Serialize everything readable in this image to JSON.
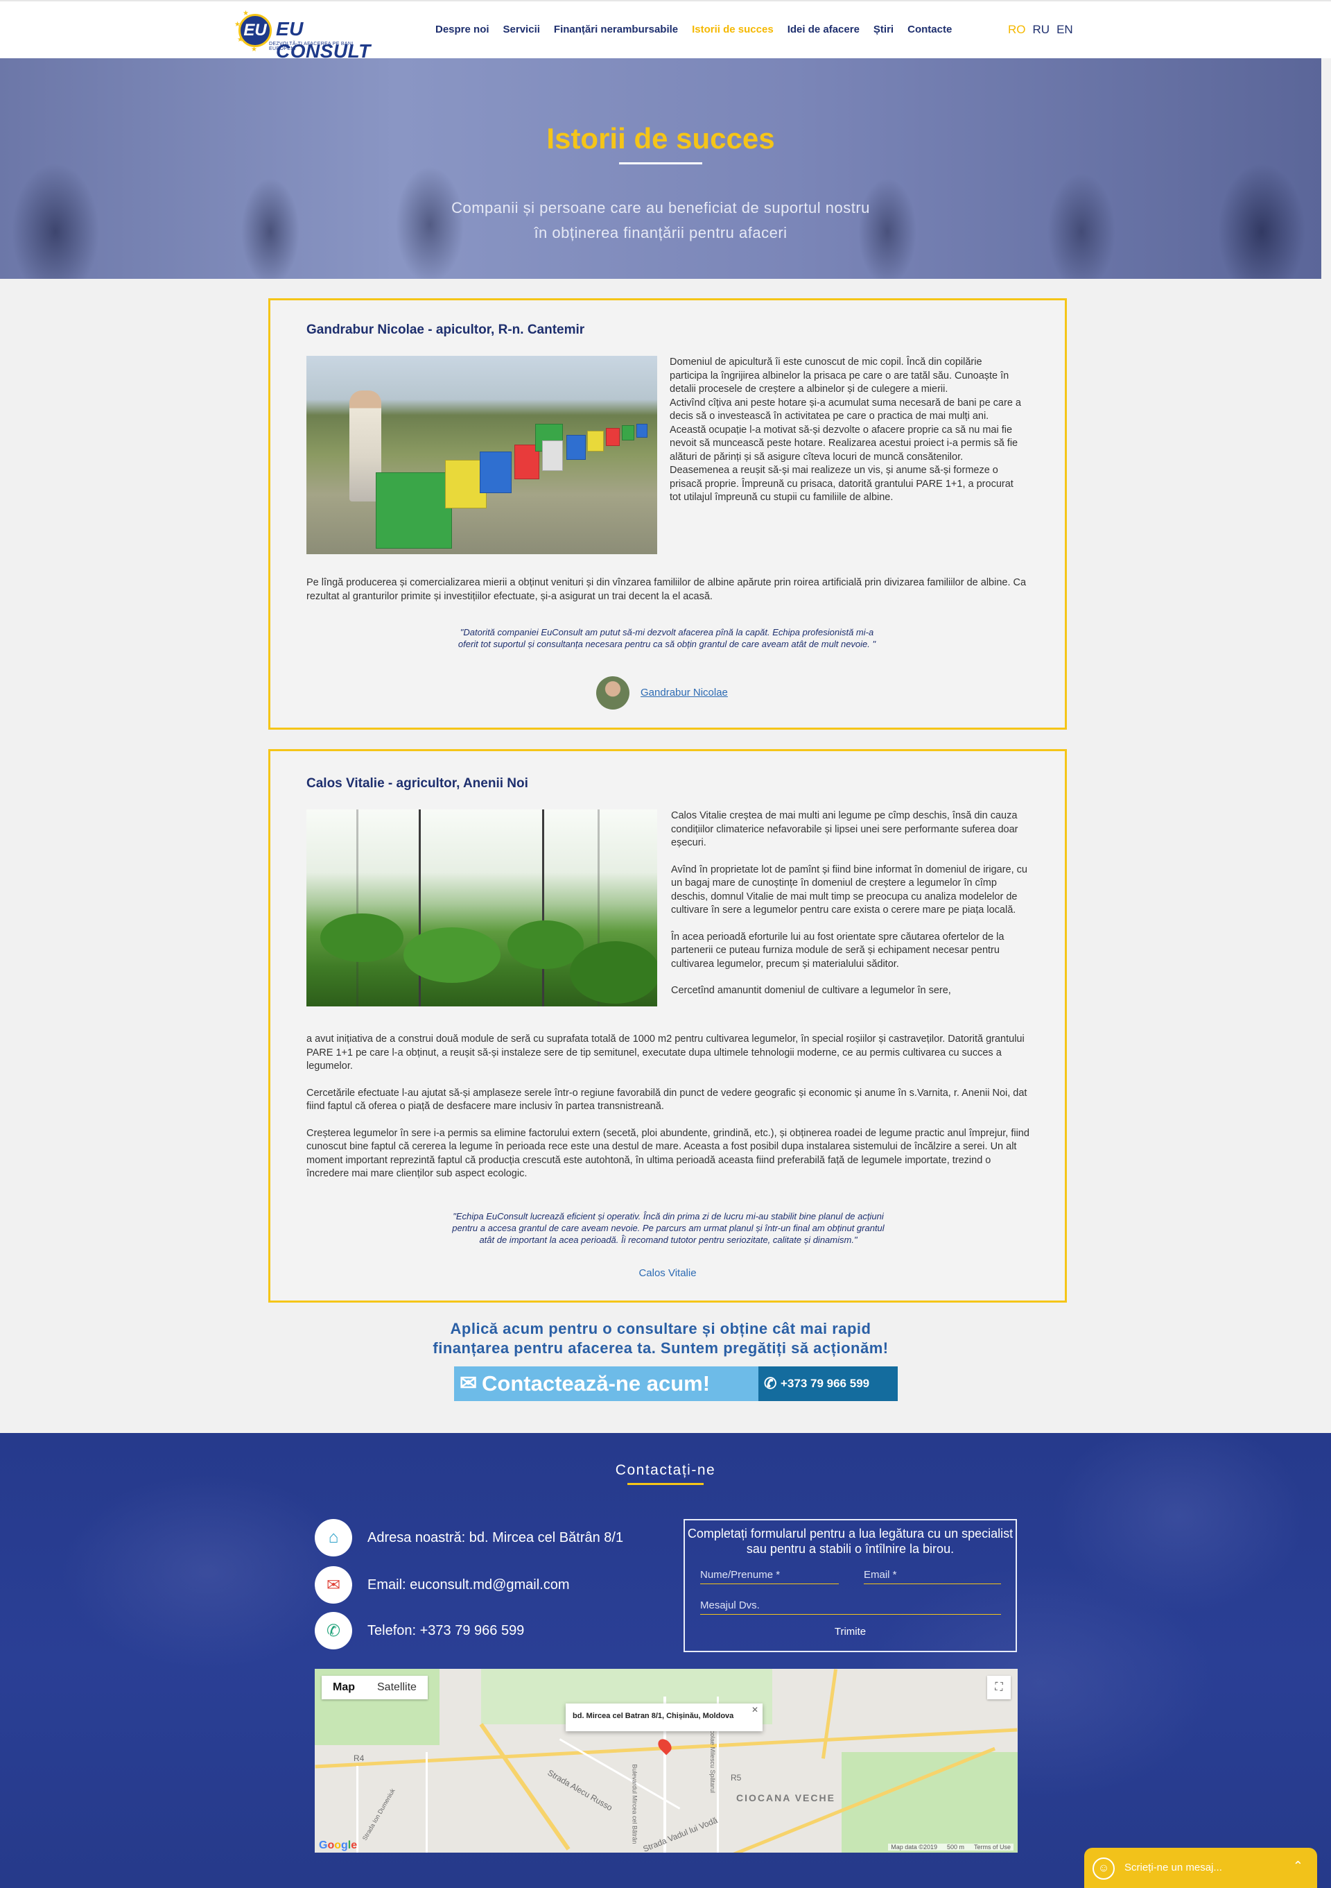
{
  "header": {
    "logo_main": "EU CONSULT",
    "logo_badge": "EU",
    "logo_tagline": "DEZVOLTĂ-ȚI AFACEREA PE BANI EUROPENI",
    "nav": [
      {
        "label": "Despre noi"
      },
      {
        "label": "Servicii"
      },
      {
        "label": "Finanțări nerambursabile"
      },
      {
        "label": "Istorii de succes",
        "active": true
      },
      {
        "label": "Idei de afacere"
      },
      {
        "label": "Știri"
      },
      {
        "label": "Contacte"
      }
    ],
    "languages": [
      "RO",
      "RU",
      "EN"
    ],
    "active_language": "RO"
  },
  "hero": {
    "title": "Istorii de succes",
    "subtitle_line1": "Companii și persoane care au beneficiat de suportul nostru",
    "subtitle_line2": "în obținerea finanțării pentru afaceri"
  },
  "stories": [
    {
      "title": "Gandrabur Nicolae - apicultor, R-n. Cantemir",
      "paragraphs": [
        "Domeniul de apicultură îi este cunoscut de mic copil. Încă din copilărie participa la îngrijirea albinelor la prisaca pe care o are tatăl său. Cunoaște în detalii procesele de creștere a albinelor și de culegere a mierii.",
        "Activînd cîțiva ani peste hotare și-a acumulat suma necesară de bani pe care a decis să o investească în activitatea pe care o practica de mai mulți ani.",
        "Această ocupație l-a motivat să-și dezvolte o afacere proprie ca să nu mai fie nevoit să muncească peste hotare. Realizarea acestui proiect i-a permis să fie alături de părinți și să asigure cîteva locuri de muncă consătenilor. Deasemenea a reușit să-și mai realizeze un vis, și anume să-și formeze o prisacă proprie. Împreună cu prisaca, datorită grantului PARE 1+1, a procurat tot utilajul împreună cu stupii cu familiile de albine."
      ],
      "full_text": "Pe lîngă producerea și comercializarea mierii a obținut venituri și din vînzarea familiilor de albine apărute prin roirea artificială prin divizarea familiilor de albine. Ca rezultat al granturilor primite și investițiilor efectuate, și-a asigurat un trai decent la el acasă.",
      "quote": "\"Datorită companiei EuConsult am putut să-mi dezvolt afacerea pînă la capăt. Echipa profesionistă mi-a oferit tot suportul și consultanța necesara pentru ca să obțin grantul de care aveam atât de mult nevoie. \"",
      "author": "Gandrabur Nicolae"
    },
    {
      "title": "Calos Vitalie - agricultor, Anenii Noi",
      "paragraphs": [
        "Calos Vitalie creștea de mai multi ani legume pe cîmp deschis, însă din cauza condițiilor climaterice nefavorabile și lipsei unei sere performante suferea doar eșecuri.",
        "Avînd în proprietate lot de pamînt și fiind bine informat în domeniul de irigare, cu un bagaj mare de cunoștințe în domeniul de creștere a legumelor în cîmp deschis, domnul Vitalie de mai mult timp se preocupa cu analiza modelelor de cultivare în sere a legumelor pentru care exista o cerere mare pe piața locală.",
        "În acea perioadă eforturile lui au fost orientate spre căutarea ofertelor de la partenerii ce puteau furniza module de seră și echipament necesar pentru cultivarea legumelor, precum și materialului săditor.",
        "Cercetînd amanuntit domeniul de cultivare a legumelor în sere,"
      ],
      "full_paragraphs": [
        "a avut inițiativa de a construi două module de seră cu suprafata totală de 1000 m2 pentru cultivarea legumelor, în special roșiilor și castraveților. Datorită grantului PARE 1+1 pe care l-a obținut, a reușit să-și instaleze sere de tip semitunel, executate dupa ultimele tehnologii moderne, ce au permis cultivarea cu succes a legumelor.",
        "Cercetările efectuate l-au ajutat să-și amplaseze serele într-o regiune favorabilă din punct de vedere geografic și economic și anume în s.Varnita, r. Anenii Noi, dat fiind faptul că oferea o piață de desfacere mare inclusiv în partea transnistreană.",
        "Creșterea legumelor în sere i-a permis sa elimine factorului extern (secetă, ploi abundente, grindină, etc.), și obținerea roadei de legume practic anul împrejur, fiind cunoscut bine faptul că cererea la legume în perioada rece este una destul de mare. Aceasta a fost posibil dupa instalarea sistemului de încălzire a serei. Un alt moment important reprezintă faptul că producția crescută este autohtonă, în ultima perioadă aceasta fiind preferabilă față de legumele importate, trezind o încredere mai mare clienților sub aspect ecologic."
      ],
      "quote": "\"Echipa EuConsult lucrează eficient și operativ. Încă din prima zi de lucru mi-au stabilit bine planul de acțiuni pentru a accesa grantul de care aveam nevoie. Pe parcurs am urmat planul și într-un final am obținut grantul atât de important la acea perioadă. Îi recomand tutotor pentru seriozitate, calitate și dinamism.\"",
      "author": "Calos Vitalie"
    }
  ],
  "cta": {
    "line1": "Aplică acum pentru o consultare și obține cât mai rapid",
    "line2": "finanțarea pentru afacerea ta. Suntem pregătiți să acționăm!",
    "button": "Contactează-ne acum!",
    "phone": "+373 79 966 599"
  },
  "footer": {
    "title": "Contactați-ne",
    "address": "Adresa noastră: bd. Mircea cel Bătrân 8/1",
    "email": "Email: euconsult.md@gmail.com",
    "phone": "Telefon: +373 79 966 599",
    "form": {
      "title": "Completați formularul pentru a lua legătura cu un specialist sau pentru a stabili o întîlnire la birou.",
      "name_placeholder": "Nume/Prenume *",
      "email_placeholder": "Email *",
      "message_placeholder": "Mesajul Dvs.",
      "submit": "Trimite"
    }
  },
  "map": {
    "tab_map": "Map",
    "tab_satellite": "Satellite",
    "popup": "bd. Mircea cel Batran 8/1, Chișinău, Moldova",
    "district": "CIOCANA VECHE",
    "streets": [
      "Strada Alecu Russo",
      "Strada Vadul lui Vodă",
      "Bulevardul Mircea cel Bătrân",
      "Strada Nicolae Milescu Spătarul",
      "Strada Ion Dumeniuk"
    ],
    "road_badges": [
      "R4",
      "R5"
    ],
    "attribution": [
      "Map data ©2019",
      "500 m",
      "Terms of Use"
    ],
    "google": [
      "G",
      "o",
      "o",
      "g",
      "l",
      "e"
    ]
  },
  "chat": {
    "placeholder": "Scrieți-ne un mesaj..."
  }
}
